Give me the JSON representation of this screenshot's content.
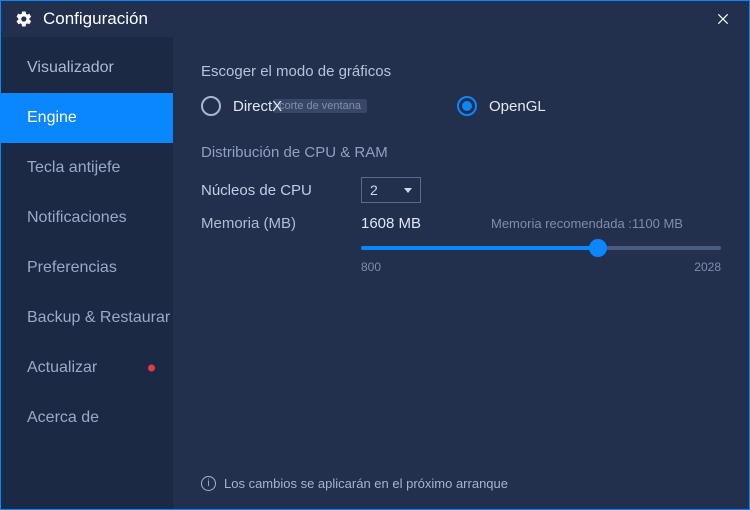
{
  "window": {
    "title": "Configuración"
  },
  "sidebar": {
    "items": [
      {
        "label": "Visualizador",
        "active": false,
        "notify": false
      },
      {
        "label": "Engine",
        "active": true,
        "notify": false
      },
      {
        "label": "Tecla antijefe",
        "active": false,
        "notify": false
      },
      {
        "label": "Notificaciones",
        "active": false,
        "notify": false
      },
      {
        "label": "Preferencias",
        "active": false,
        "notify": false
      },
      {
        "label": "Backup & Restaurar",
        "active": false,
        "notify": false
      },
      {
        "label": "Actualizar",
        "active": false,
        "notify": true
      },
      {
        "label": "Acerca de",
        "active": false,
        "notify": false
      }
    ]
  },
  "graphics": {
    "section_title": "Escoger el modo de gráficos",
    "options": {
      "directx": {
        "label": "DirectX",
        "selected": false
      },
      "opengl": {
        "label": "OpenGL",
        "selected": true
      }
    },
    "ghost_hint": "corte de ventana"
  },
  "cpu_ram": {
    "section_title": "Distribución de CPU & RAM",
    "cores_label": "Núcleos de CPU",
    "cores_value": "2",
    "memory_label": "Memoria (MB)",
    "memory_value": "1608 MB",
    "memory_recommended": "Memoria recomendada :1100 MB",
    "slider": {
      "min": "800",
      "max": "2028",
      "value": 1608
    }
  },
  "footer": {
    "note": "Los cambios se aplicarán en el próximo arranque"
  }
}
